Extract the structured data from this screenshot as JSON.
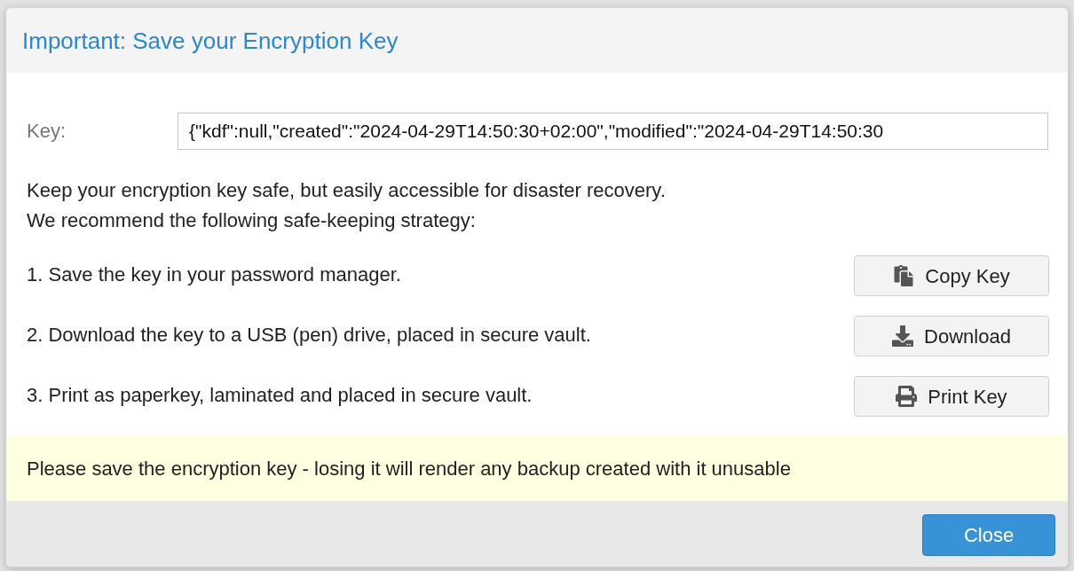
{
  "dialog": {
    "title": "Important: Save your Encryption Key"
  },
  "key_field": {
    "label": "Key:",
    "value": "{\"kdf\":null,\"created\":\"2024-04-29T14:50:30+02:00\",\"modified\":\"2024-04-29T14:50:30"
  },
  "intro": [
    "Keep your encryption key safe, but easily accessible for disaster recovery.",
    "We recommend the following safe-keeping strategy:"
  ],
  "steps": [
    {
      "text": "1. Save the key in your password manager.",
      "button": {
        "label": "Copy Key",
        "kind": "copy"
      }
    },
    {
      "text": "2. Download the key to a USB (pen) drive, placed in secure vault.",
      "button": {
        "label": "Download",
        "kind": "download"
      }
    },
    {
      "text": "3. Print as paperkey, laminated and placed in secure vault.",
      "button": {
        "label": "Print Key",
        "kind": "print"
      }
    }
  ],
  "warning": "Please save the encryption key - losing it will render any backup created with it unusable",
  "footer": {
    "buttons": [
      {
        "label": "Close",
        "kind": "primary"
      }
    ]
  }
}
